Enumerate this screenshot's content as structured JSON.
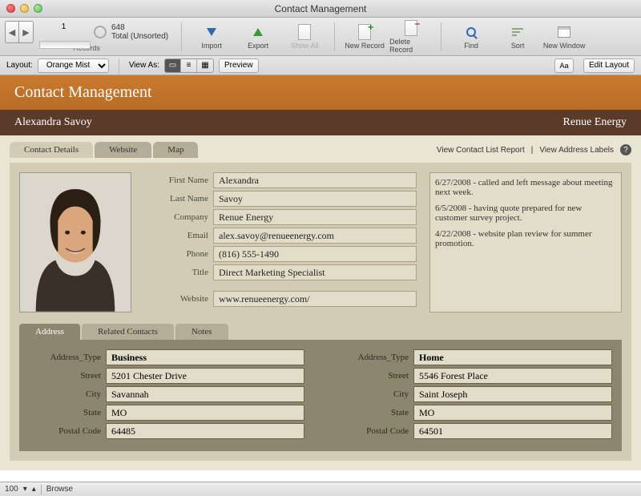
{
  "window": {
    "title": "Contact Management"
  },
  "toolbar": {
    "record_number": "1",
    "total": "648",
    "total_label": "Total (Unsorted)",
    "records_label": "Records",
    "import": "Import",
    "export": "Export",
    "show_all": "Show All",
    "new_record": "New Record",
    "delete_record": "Delete Record",
    "find": "Find",
    "sort": "Sort",
    "new_window": "New Window"
  },
  "layoutbar": {
    "layout_label": "Layout:",
    "layout_selected": "Orange Mist",
    "view_as": "View As:",
    "preview": "Preview",
    "aa": "Aa",
    "edit_layout": "Edit Layout"
  },
  "header": {
    "title": "Contact Management",
    "name": "Alexandra Savoy",
    "company": "Renue Energy"
  },
  "tabs": {
    "t1": "Contact Details",
    "t2": "Website",
    "t3": "Map"
  },
  "reports": {
    "list": "View Contact List Report",
    "labels": "View Address Labels"
  },
  "fields": {
    "first_name_l": "First Name",
    "first_name": "Alexandra",
    "last_name_l": "Last Name",
    "last_name": "Savoy",
    "company_l": "Company",
    "company": "Renue Energy",
    "email_l": "Email",
    "email": "alex.savoy@renueenergy.com",
    "phone_l": "Phone",
    "phone": "(816) 555-1490",
    "title_l": "Title",
    "title": "Direct Marketing Specialist",
    "website_l": "Website",
    "website": "www.renueenergy.com/"
  },
  "notes": {
    "n1": "6/27/2008 - called and left message about meeting next week.",
    "n2": "6/5/2008 - having quote prepared for new customer survey project.",
    "n3": "4/22/2008 - website plan review for summer promotion."
  },
  "subtabs": {
    "t1": "Address",
    "t2": "Related Contacts",
    "t3": "Notes"
  },
  "addr_labels": {
    "type": "Address_Type",
    "street": "Street",
    "city": "City",
    "state": "State",
    "postal": "Postal Code"
  },
  "addr1": {
    "type": "Business",
    "street": "5201 Chester Drive",
    "city": "Savannah",
    "state": "MO",
    "postal": "64485"
  },
  "addr2": {
    "type": "Home",
    "street": "5546 Forest Place",
    "city": "Saint Joseph",
    "state": "MO",
    "postal": "64501"
  },
  "status": {
    "zoom": "100",
    "mode": "Browse"
  }
}
